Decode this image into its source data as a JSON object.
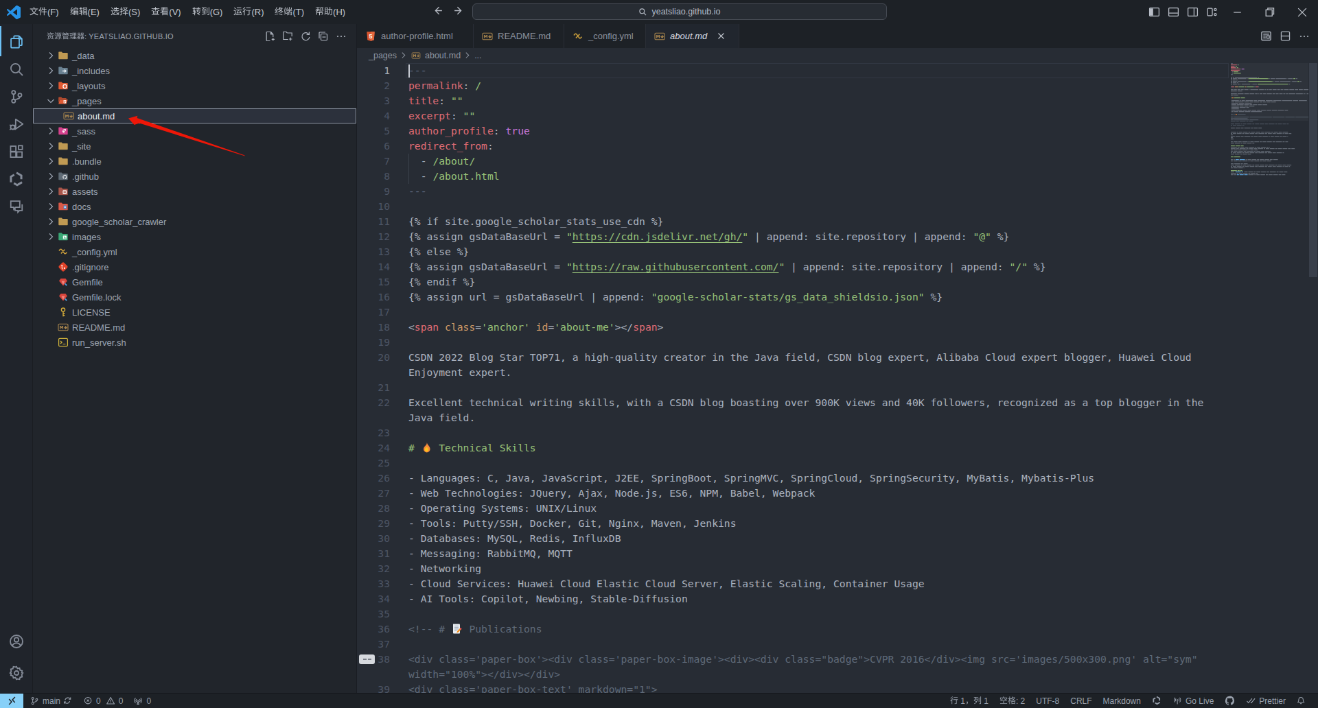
{
  "window": {
    "search_value": "yeatsliao.github.io",
    "menus": [
      "文件(F)",
      "编辑(E)",
      "选择(S)",
      "查看(V)",
      "转到(G)",
      "运行(R)",
      "终端(T)",
      "帮助(H)"
    ],
    "layout_controls": [
      "toggle-primary-sidebar",
      "toggle-panel",
      "toggle-secondary-sidebar",
      "customize-layout"
    ],
    "window_controls": [
      "minimize",
      "maximize",
      "close"
    ]
  },
  "activity_bar": {
    "top": [
      {
        "name": "explorer",
        "active": true
      },
      {
        "name": "search"
      },
      {
        "name": "source-control"
      },
      {
        "name": "run-debug"
      },
      {
        "name": "extensions"
      },
      {
        "name": "tongyi-lingma"
      },
      {
        "name": "comments"
      }
    ],
    "bottom": [
      {
        "name": "account"
      },
      {
        "name": "settings"
      }
    ]
  },
  "sidebar": {
    "title": "资源管理器: YEATSLIAO.GITHUB.IO",
    "actions": [
      "new-file",
      "new-folder",
      "refresh",
      "collapse-all",
      "more"
    ],
    "tree": [
      {
        "label": "_data",
        "icon": "folder",
        "chevron": "collapsed"
      },
      {
        "label": "_includes",
        "icon": "folder-include",
        "chevron": "collapsed"
      },
      {
        "label": "_layouts",
        "icon": "folder-layout",
        "chevron": "collapsed"
      },
      {
        "label": "_pages",
        "icon": "folder-pages-open",
        "chevron": "expanded"
      },
      {
        "label": "about.md",
        "icon": "markdown",
        "child": true,
        "selected": true
      },
      {
        "label": "_sass",
        "icon": "folder-sass",
        "chevron": "collapsed"
      },
      {
        "label": "_site",
        "icon": "folder",
        "chevron": "collapsed"
      },
      {
        "label": ".bundle",
        "icon": "folder",
        "chevron": "collapsed"
      },
      {
        "label": ".github",
        "icon": "folder-github",
        "chevron": "collapsed"
      },
      {
        "label": "assets",
        "icon": "folder-assets",
        "chevron": "collapsed"
      },
      {
        "label": "docs",
        "icon": "folder-docs",
        "chevron": "collapsed"
      },
      {
        "label": "google_scholar_crawler",
        "icon": "folder",
        "chevron": "collapsed"
      },
      {
        "label": "images",
        "icon": "folder-images",
        "chevron": "collapsed"
      },
      {
        "label": "_config.yml",
        "icon": "yaml"
      },
      {
        "label": ".gitignore",
        "icon": "git"
      },
      {
        "label": "Gemfile",
        "icon": "gem"
      },
      {
        "label": "Gemfile.lock",
        "icon": "gem"
      },
      {
        "label": "LICENSE",
        "icon": "license"
      },
      {
        "label": "README.md",
        "icon": "markdown"
      },
      {
        "label": "run_server.sh",
        "icon": "shell"
      }
    ]
  },
  "tabs": [
    {
      "label": "author-profile.html",
      "icon": "html",
      "width": 170
    },
    {
      "label": "README.md",
      "icon": "markdown",
      "width": 132
    },
    {
      "label": "_config.yml",
      "icon": "yaml",
      "width": 119
    },
    {
      "label": "about.md",
      "icon": "markdown",
      "width": 136,
      "active": true,
      "close": true
    }
  ],
  "editor_actions": [
    "open-preview",
    "split-editor",
    "more"
  ],
  "breadcrumbs": [
    {
      "label": "_pages"
    },
    {
      "label": "about.md",
      "icon": "markdown"
    },
    {
      "label": "..."
    }
  ],
  "editor": {
    "current_line": 1,
    "gutter_marker_row": 39,
    "indent_guide": {
      "row_start": 6,
      "row_end": 7
    },
    "rows": [
      {
        "n": 1,
        "segs": [
          [
            "f",
            "---"
          ]
        ]
      },
      {
        "n": 2,
        "segs": [
          [
            "r",
            "permalink"
          ],
          [
            "d",
            ": "
          ],
          [
            "g",
            "/"
          ]
        ]
      },
      {
        "n": 3,
        "segs": [
          [
            "r",
            "title"
          ],
          [
            "d",
            ": "
          ],
          [
            "g",
            "\"\""
          ]
        ]
      },
      {
        "n": 4,
        "segs": [
          [
            "r",
            "excerpt"
          ],
          [
            "d",
            ": "
          ],
          [
            "g",
            "\"\""
          ]
        ]
      },
      {
        "n": 5,
        "segs": [
          [
            "r",
            "author_profile"
          ],
          [
            "d",
            ": "
          ],
          [
            "p",
            "true"
          ]
        ]
      },
      {
        "n": 6,
        "segs": [
          [
            "r",
            "redirect_from"
          ],
          [
            "d",
            ":"
          ]
        ]
      },
      {
        "n": 7,
        "segs": [
          [
            "d",
            "  - "
          ],
          [
            "g",
            "/about/"
          ]
        ]
      },
      {
        "n": 8,
        "segs": [
          [
            "d",
            "  - "
          ],
          [
            "g",
            "/about.html"
          ]
        ]
      },
      {
        "n": 9,
        "segs": [
          [
            "f",
            "---"
          ]
        ]
      },
      {
        "n": 10,
        "segs": []
      },
      {
        "n": 11,
        "segs": [
          [
            "d",
            "{% if site.google_scholar_stats_use_cdn %}"
          ]
        ]
      },
      {
        "n": 12,
        "segs": [
          [
            "d",
            "{% assign gsDataBaseUrl = "
          ],
          [
            "g",
            "\""
          ],
          [
            "gu",
            "https://cdn.jsdelivr.net/gh/"
          ],
          [
            "g",
            "\""
          ],
          [
            "d",
            " | append: site.repository | append: "
          ],
          [
            "g",
            "\"@\""
          ],
          [
            "d",
            " %}"
          ]
        ]
      },
      {
        "n": 13,
        "segs": [
          [
            "d",
            "{% else %}"
          ]
        ]
      },
      {
        "n": 14,
        "segs": [
          [
            "d",
            "{% assign gsDataBaseUrl = "
          ],
          [
            "g",
            "\""
          ],
          [
            "gu",
            "https://raw.githubusercontent.com/"
          ],
          [
            "g",
            "\""
          ],
          [
            "d",
            " | append: site.repository | append: "
          ],
          [
            "g",
            "\"/\""
          ],
          [
            "d",
            " %}"
          ]
        ]
      },
      {
        "n": 15,
        "segs": [
          [
            "d",
            "{% endif %}"
          ]
        ]
      },
      {
        "n": 16,
        "segs": [
          [
            "d",
            "{% assign url = gsDataBaseUrl | append: "
          ],
          [
            "g",
            "\"google-scholar-stats/gs_data_shieldsio.json\""
          ],
          [
            "d",
            " %}"
          ]
        ]
      },
      {
        "n": 17,
        "segs": []
      },
      {
        "n": 18,
        "segs": [
          [
            "d",
            "<"
          ],
          [
            "r",
            "span"
          ],
          [
            "d",
            " "
          ],
          [
            "o",
            "class"
          ],
          [
            "d",
            "="
          ],
          [
            "g",
            "'anchor'"
          ],
          [
            "d",
            " "
          ],
          [
            "o",
            "id"
          ],
          [
            "d",
            "="
          ],
          [
            "g",
            "'about-me'"
          ],
          [
            "d",
            "></"
          ],
          [
            "r",
            "span"
          ],
          [
            "d",
            ">"
          ]
        ]
      },
      {
        "n": 19,
        "segs": []
      },
      {
        "n": 20,
        "segs": [
          [
            "d",
            "CSDN 2022 Blog Star TOP71, a high-quality creator in the Java field, CSDN blog expert, Alibaba Cloud expert blogger, Huawei Cloud"
          ]
        ]
      },
      {
        "n": "",
        "segs": [
          [
            "d",
            "Enjoyment expert."
          ]
        ]
      },
      {
        "n": 21,
        "segs": []
      },
      {
        "n": 22,
        "segs": [
          [
            "d",
            "Excellent technical writing skills, with a CSDN blog boasting over 900K views and 40K followers, recognized as a top blogger in the"
          ]
        ]
      },
      {
        "n": "",
        "segs": [
          [
            "d",
            "Java field."
          ]
        ]
      },
      {
        "n": 23,
        "segs": []
      },
      {
        "n": 24,
        "segs": [
          [
            "g",
            "# "
          ],
          [
            "e",
            "fire"
          ],
          [
            "g",
            " Technical Skills"
          ]
        ]
      },
      {
        "n": 25,
        "segs": []
      },
      {
        "n": 26,
        "segs": [
          [
            "d",
            "- Languages: C, Java, JavaScript, J2EE, SpringBoot, SpringMVC, SpringCloud, SpringSecurity, MyBatis, Mybatis-Plus"
          ]
        ]
      },
      {
        "n": 27,
        "segs": [
          [
            "d",
            "- Web Technologies: JQuery, Ajax, Node.js, ES6, NPM, Babel, Webpack"
          ]
        ]
      },
      {
        "n": 28,
        "segs": [
          [
            "d",
            "- Operating Systems: UNIX/Linux"
          ]
        ]
      },
      {
        "n": 29,
        "segs": [
          [
            "d",
            "- Tools: Putty/SSH, Docker, Git, Nginx, Maven, Jenkins"
          ]
        ]
      },
      {
        "n": 30,
        "segs": [
          [
            "d",
            "- Databases: MySQL, Redis, InfluxDB"
          ]
        ]
      },
      {
        "n": 31,
        "segs": [
          [
            "d",
            "- Messaging: RabbitMQ, MQTT"
          ]
        ]
      },
      {
        "n": 32,
        "segs": [
          [
            "d",
            "- Networking"
          ]
        ]
      },
      {
        "n": 33,
        "segs": [
          [
            "d",
            "- Cloud Services: Huawei Cloud Elastic Cloud Server, Elastic Scaling, Container Usage"
          ]
        ]
      },
      {
        "n": 34,
        "segs": [
          [
            "d",
            "- AI Tools: Copilot, Newbing, Stable-Diffusion"
          ]
        ]
      },
      {
        "n": 35,
        "segs": []
      },
      {
        "n": 36,
        "segs": [
          [
            "c",
            "<!-- # "
          ],
          [
            "e",
            "memo"
          ],
          [
            "c",
            " Publications"
          ]
        ]
      },
      {
        "n": 37,
        "segs": []
      },
      {
        "n": 38,
        "segs": [
          [
            "c",
            "<div class='paper-box'><div class='paper-box-image'><div><div class=\"badge\">CVPR 2016</div><img src='images/500x300.png' alt=\"sym\""
          ]
        ]
      },
      {
        "n": "",
        "segs": [
          [
            "c",
            "width=\"100%\"></div></div>"
          ]
        ]
      },
      {
        "n": 39,
        "segs": [
          [
            "c",
            "<div class='paper-box-text' markdown=\"1\">"
          ]
        ]
      }
    ]
  },
  "minimap": {
    "extra_rows": [
      [
        [
          "c",
          0,
          34
        ]
      ],
      [],
      [
        [
          "c",
          0,
          86
        ]
      ],
      [
        [
          "c",
          0,
          20
        ]
      ],
      [],
      [
        [
          "d",
          0,
          46
        ]
      ],
      [],
      [],
      [
        [
          "d",
          0,
          85
        ]
      ],
      [
        [
          "d",
          0,
          90
        ]
      ],
      [
        [
          "d",
          0,
          3
        ]
      ],
      [
        [
          "d",
          0,
          85
        ]
      ],
      [
        [
          "d",
          0,
          3
        ]
      ],
      [
        [
          "d",
          0,
          4
        ]
      ],
      [],
      [
        [
          "d",
          0,
          85
        ]
      ],
      [
        [
          "d",
          0,
          35
        ]
      ],
      [],
      [
        [
          "g",
          0,
          20
        ]
      ],
      [
        [
          "d",
          0,
          58
        ]
      ],
      [
        [
          "d",
          0,
          95
        ]
      ],
      [
        [
          "d",
          0,
          40
        ]
      ],
      [
        [
          "d",
          0,
          60
        ]
      ],
      [
        [
          "d",
          0,
          80
        ]
      ],
      [
        [
          "d",
          0,
          30
        ]
      ],
      [],
      [
        [
          "g",
          0,
          14
        ]
      ],
      [],
      [
        [
          "d",
          0,
          6
        ],
        [
          "b",
          7,
          14
        ],
        [
          "d",
          22,
          48
        ]
      ],
      [
        [
          "d",
          0,
          60
        ]
      ],
      [],
      [
        [
          "d",
          0,
          25
        ]
      ],
      [
        [
          "d",
          0,
          90
        ]
      ],
      [
        [
          "d",
          0,
          88
        ]
      ],
      [
        [
          "d",
          0,
          20
        ]
      ],
      [],
      [
        [
          "g",
          0,
          17
        ]
      ],
      [
        [
          "d",
          0,
          6
        ],
        [
          "b",
          7,
          12
        ],
        [
          "d",
          20,
          65
        ]
      ],
      [
        [
          "d",
          0,
          40
        ]
      ],
      [
        [
          "d",
          0,
          8
        ],
        [
          "b",
          9,
          16
        ],
        [
          "d",
          26,
          55
        ]
      ]
    ]
  },
  "status_bar": {
    "left": [
      {
        "name": "remote",
        "icon": "remote"
      },
      {
        "name": "git-branch",
        "icon": "git-branch",
        "label": "main",
        "icon2": "sync"
      },
      {
        "name": "problems",
        "errors": "0",
        "warnings": "0"
      },
      {
        "name": "ports",
        "icon": "radio-tower",
        "label": "0"
      }
    ],
    "right": [
      {
        "name": "cursor-position",
        "label": "行 1，列 1"
      },
      {
        "name": "indentation",
        "label": "空格: 2"
      },
      {
        "name": "encoding",
        "label": "UTF-8"
      },
      {
        "name": "eol",
        "label": "CRLF"
      },
      {
        "name": "language-mode",
        "label": "Markdown"
      },
      {
        "name": "tongyi-lingma",
        "icon": "tongyi"
      },
      {
        "name": "live-server",
        "icon": "broadcast",
        "label": "Go Live"
      },
      {
        "name": "github",
        "icon": "github"
      },
      {
        "name": "prettier",
        "icon": "double-check",
        "label": "Prettier"
      },
      {
        "name": "notifications",
        "icon": "bell"
      }
    ]
  }
}
